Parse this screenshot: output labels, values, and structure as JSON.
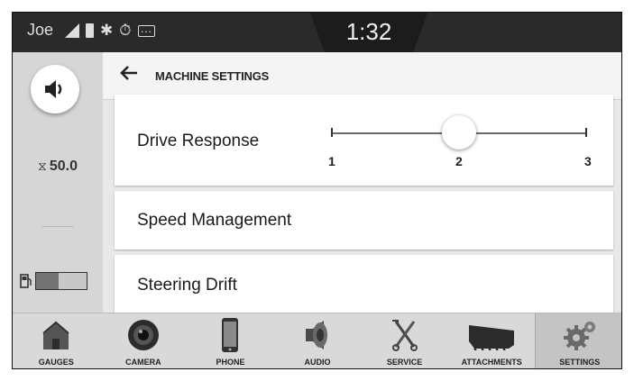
{
  "status": {
    "user": "Joe",
    "time": "1:32"
  },
  "left": {
    "hours": "50.0",
    "fuel_level_fraction": 0.45
  },
  "header": {
    "title": "MACHINE SETTINGS"
  },
  "settings": [
    {
      "label": "Drive Response",
      "slider": {
        "min": "1",
        "mid": "2",
        "max": "3",
        "value": 2
      }
    },
    {
      "label": "Speed Management"
    },
    {
      "label": "Steering Drift"
    }
  ],
  "nav": {
    "items": [
      {
        "label": "GAUGES",
        "icon": "house-icon"
      },
      {
        "label": "CAMERA",
        "icon": "camera-icon"
      },
      {
        "label": "PHONE",
        "icon": "phone-icon"
      },
      {
        "label": "AUDIO",
        "icon": "speaker-icon"
      },
      {
        "label": "SERVICE",
        "icon": "tools-icon"
      },
      {
        "label": "ATTACHMENTS",
        "icon": "bucket-icon"
      },
      {
        "label": "SETTINGS",
        "icon": "gear-icon",
        "active": true
      }
    ]
  }
}
